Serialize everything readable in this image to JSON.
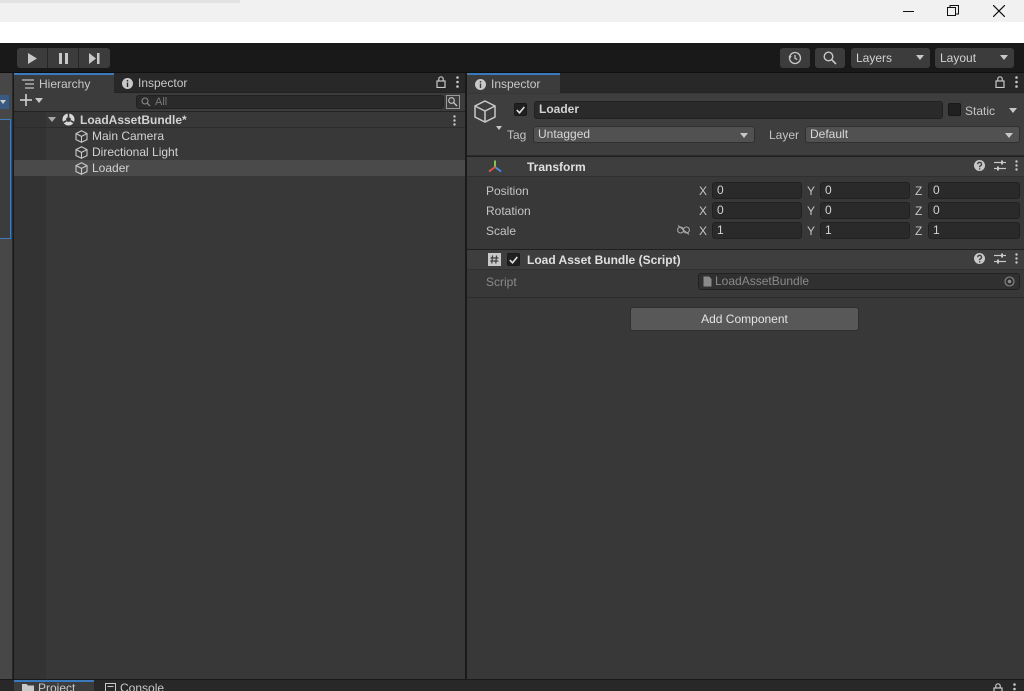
{
  "toolbar": {
    "layers_label": "Layers",
    "layout_label": "Layout"
  },
  "hierarchy": {
    "tabs": [
      "Hierarchy",
      "Inspector"
    ],
    "search_placeholder": "All",
    "scene_name": "LoadAssetBundle*",
    "items": [
      "Main Camera",
      "Directional Light",
      "Loader"
    ],
    "selected": "Loader"
  },
  "inspector": {
    "tab_label": "Inspector",
    "object_name": "Loader",
    "static_label": "Static",
    "tag_label": "Tag",
    "tag_value": "Untagged",
    "layer_label": "Layer",
    "layer_value": "Default",
    "transform": {
      "title": "Transform",
      "rows": [
        {
          "label": "Position",
          "x": "0",
          "y": "0",
          "z": "0"
        },
        {
          "label": "Rotation",
          "x": "0",
          "y": "0",
          "z": "0"
        },
        {
          "label": "Scale",
          "x": "1",
          "y": "1",
          "z": "1"
        }
      ],
      "axes": [
        "X",
        "Y",
        "Z"
      ]
    },
    "script_component": {
      "title": "Load Asset Bundle (Script)",
      "field_label": "Script",
      "field_value": "LoadAssetBundle"
    },
    "add_component_label": "Add Component"
  },
  "bottom": {
    "tabs": [
      "Project",
      "Console"
    ]
  },
  "colors": {
    "accent": "#3a79bb",
    "panel": "#383838",
    "toolbar": "#191919"
  }
}
